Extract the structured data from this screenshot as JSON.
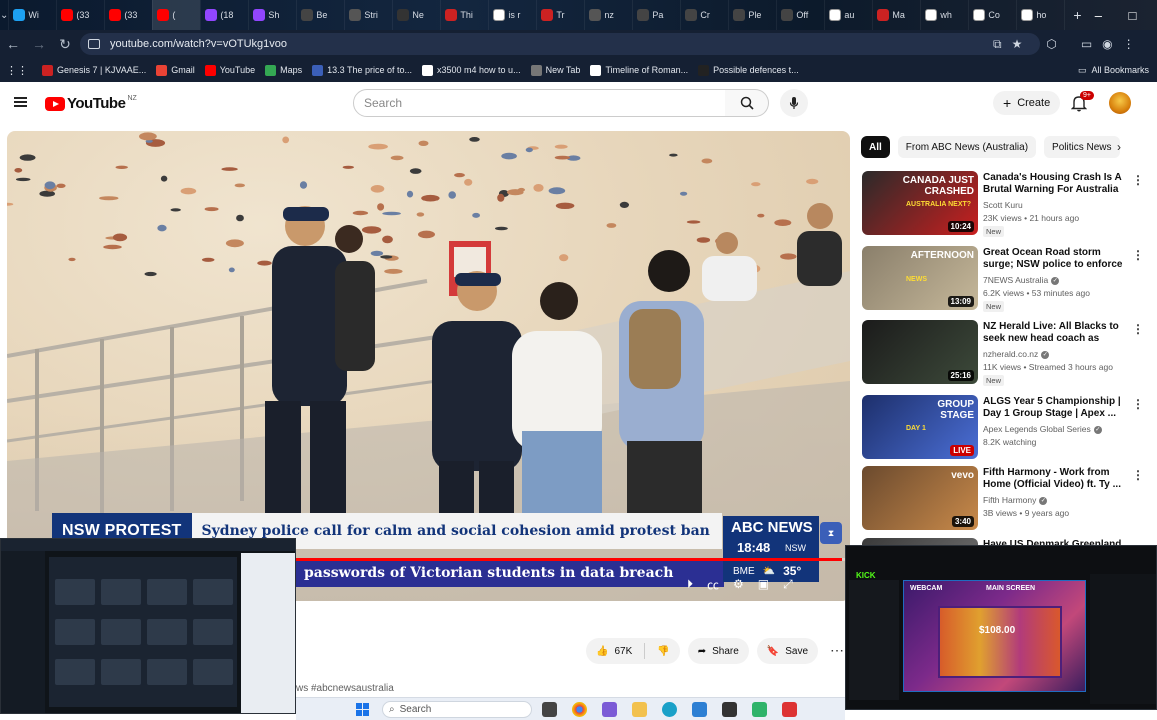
{
  "browser": {
    "tabs": [
      {
        "label": "Wi",
        "icon": "plus-icon",
        "color": "#1da1f2"
      },
      {
        "label": "(33",
        "icon": "youtube-icon",
        "color": "#ff0000"
      },
      {
        "label": "(33",
        "icon": "youtube-icon",
        "color": "#ff0000"
      },
      {
        "label": "(",
        "icon": "audio-icon",
        "color": "#ff0000"
      },
      {
        "label": "(18",
        "icon": "twitch-icon",
        "color": "#9146ff"
      },
      {
        "label": "Sh",
        "icon": "twitch-icon",
        "color": "#9146ff"
      },
      {
        "label": "Be",
        "icon": "chatgpt-icon",
        "color": "#444444"
      },
      {
        "label": "Stri",
        "icon": "globe-icon",
        "color": "#555555"
      },
      {
        "label": "Ne",
        "icon": "nyt-icon",
        "color": "#333333"
      },
      {
        "label": "Thi",
        "icon": "opera-icon",
        "color": "#cc2222"
      },
      {
        "label": "is r",
        "icon": "google-icon",
        "color": "#ffffff"
      },
      {
        "label": "Tr",
        "icon": "opera-icon",
        "color": "#cc2222"
      },
      {
        "label": "nz",
        "icon": "globe-icon",
        "color": "#555555"
      },
      {
        "label": "Pa",
        "icon": "chatgpt-icon",
        "color": "#444444"
      },
      {
        "label": "Cr",
        "icon": "chatgpt-icon",
        "color": "#444444"
      },
      {
        "label": "Ple",
        "icon": "chatgpt-icon",
        "color": "#444444"
      },
      {
        "label": "Off",
        "icon": "chatgpt-icon",
        "color": "#444444"
      },
      {
        "label": "au",
        "icon": "google-icon",
        "color": "#ffffff"
      },
      {
        "label": "Ma",
        "icon": "gmail-icon",
        "color": "#cc2222"
      },
      {
        "label": "wh",
        "icon": "google-icon",
        "color": "#ffffff"
      },
      {
        "label": "Co",
        "icon": "wikipedia-icon",
        "color": "#ffffff"
      },
      {
        "label": "ho",
        "icon": "google-icon",
        "color": "#ffffff"
      }
    ],
    "new_tab": "+",
    "url": "youtube.com/watch?v=vOTUkg1voo",
    "bookmarks": [
      {
        "label": "Genesis 7 | KJVAAE...",
        "color": "#cc2222"
      },
      {
        "label": "Gmail",
        "color": "#ea4335"
      },
      {
        "label": "YouTube",
        "color": "#ff0000"
      },
      {
        "label": "Maps",
        "color": "#34a853"
      },
      {
        "label": "13.3 The price of to...",
        "color": "#3b5fb8"
      },
      {
        "label": "x3500 m4 how to u...",
        "color": "#ffffff"
      },
      {
        "label": "New Tab",
        "color": "#777777"
      },
      {
        "label": "Timeline of Roman...",
        "color": "#ffffff"
      },
      {
        "label": "Possible defences t...",
        "color": "#222222"
      }
    ],
    "all_bookmarks": "All Bookmarks"
  },
  "youtube": {
    "logo_text": "YouTube",
    "country": "NZ",
    "search_placeholder": "Search",
    "create_label": "Create",
    "notification_count": "9+"
  },
  "video": {
    "lower_third_tag": "NSW PROTEST",
    "lower_third_headline": "Sydney police call for calm and social cohesion amid protest ban",
    "ticker_text": "passwords of Victorian students in data breach",
    "brand": "ABC NEWS",
    "time": "18:48",
    "timezone": "NSW",
    "weather_label": "BME",
    "temperature": "35°",
    "progress": 0.99,
    "hashtags": "ws #abcnewsaustralia"
  },
  "actions": {
    "likes": "67K",
    "share": "Share",
    "save": "Save"
  },
  "sidebar": {
    "chips": [
      "All",
      "From ABC News (Australia)",
      "Politics News"
    ],
    "recommendations": [
      {
        "title": "Canada's Housing Crash Is A Brutal Warning For Australia ...",
        "channel": "Scott Kuru",
        "meta": "23K views • 21 hours ago",
        "badge": "New",
        "duration": "10:24",
        "thumb_text": "CANADA JUST CRASHED",
        "thumb_sub": "AUSTRALIA NEXT?",
        "colors": [
          "#2a2a2a",
          "#c91f1f"
        ]
      },
      {
        "title": "Great Ocean Road storm surge; NSW police to enforce protest ...",
        "channel": "7NEWS Australia",
        "meta": "6.2K views • 53 minutes ago",
        "badge": "New",
        "duration": "13:09",
        "thumb_text": "AFTERNOON",
        "thumb_sub": "NEWS",
        "colors": [
          "#8a7f6b",
          "#c6b89a"
        ]
      },
      {
        "title": "NZ Herald Live: All Blacks to seek new head coach as Scott...",
        "channel": "nzherald.co.nz",
        "meta": "11K views • Streamed 3 hours ago",
        "badge": "New",
        "duration": "25:16",
        "thumb_text": "",
        "thumb_sub": "",
        "colors": [
          "#1b1b1b",
          "#3d4a3a"
        ]
      },
      {
        "title": "ALGS Year 5 Championship | Day 1 Group Stage | Apex ...",
        "channel": "Apex Legends Global Series",
        "meta": "8.2K watching",
        "badge": "",
        "duration": "LIVE",
        "thumb_text": "GROUP STAGE",
        "thumb_sub": "DAY 1",
        "colors": [
          "#1d2f6b",
          "#4b6fd6"
        ]
      },
      {
        "title": "Fifth Harmony - Work from Home (Official Video) ft. Ty ...",
        "channel": "Fifth Harmony",
        "meta": "3B views • 9 years ago",
        "badge": "",
        "duration": "3:40",
        "thumb_text": "vevo",
        "thumb_sub": "",
        "colors": [
          "#6b4a2e",
          "#c98a4a"
        ]
      },
      {
        "title": "Have US Denmark Greenland",
        "channel": "",
        "meta": "",
        "badge": "",
        "duration": "",
        "thumb_text": "",
        "thumb_sub": "",
        "colors": [
          "#3a3a3a",
          "#777777"
        ]
      }
    ]
  },
  "stream_overlay": {
    "platform": "KICK",
    "webcam_label": "WEBCAM",
    "main_label": "MAIN SCREEN",
    "amount": "$108.00"
  },
  "taskbar": {
    "search_placeholder": "Search"
  }
}
